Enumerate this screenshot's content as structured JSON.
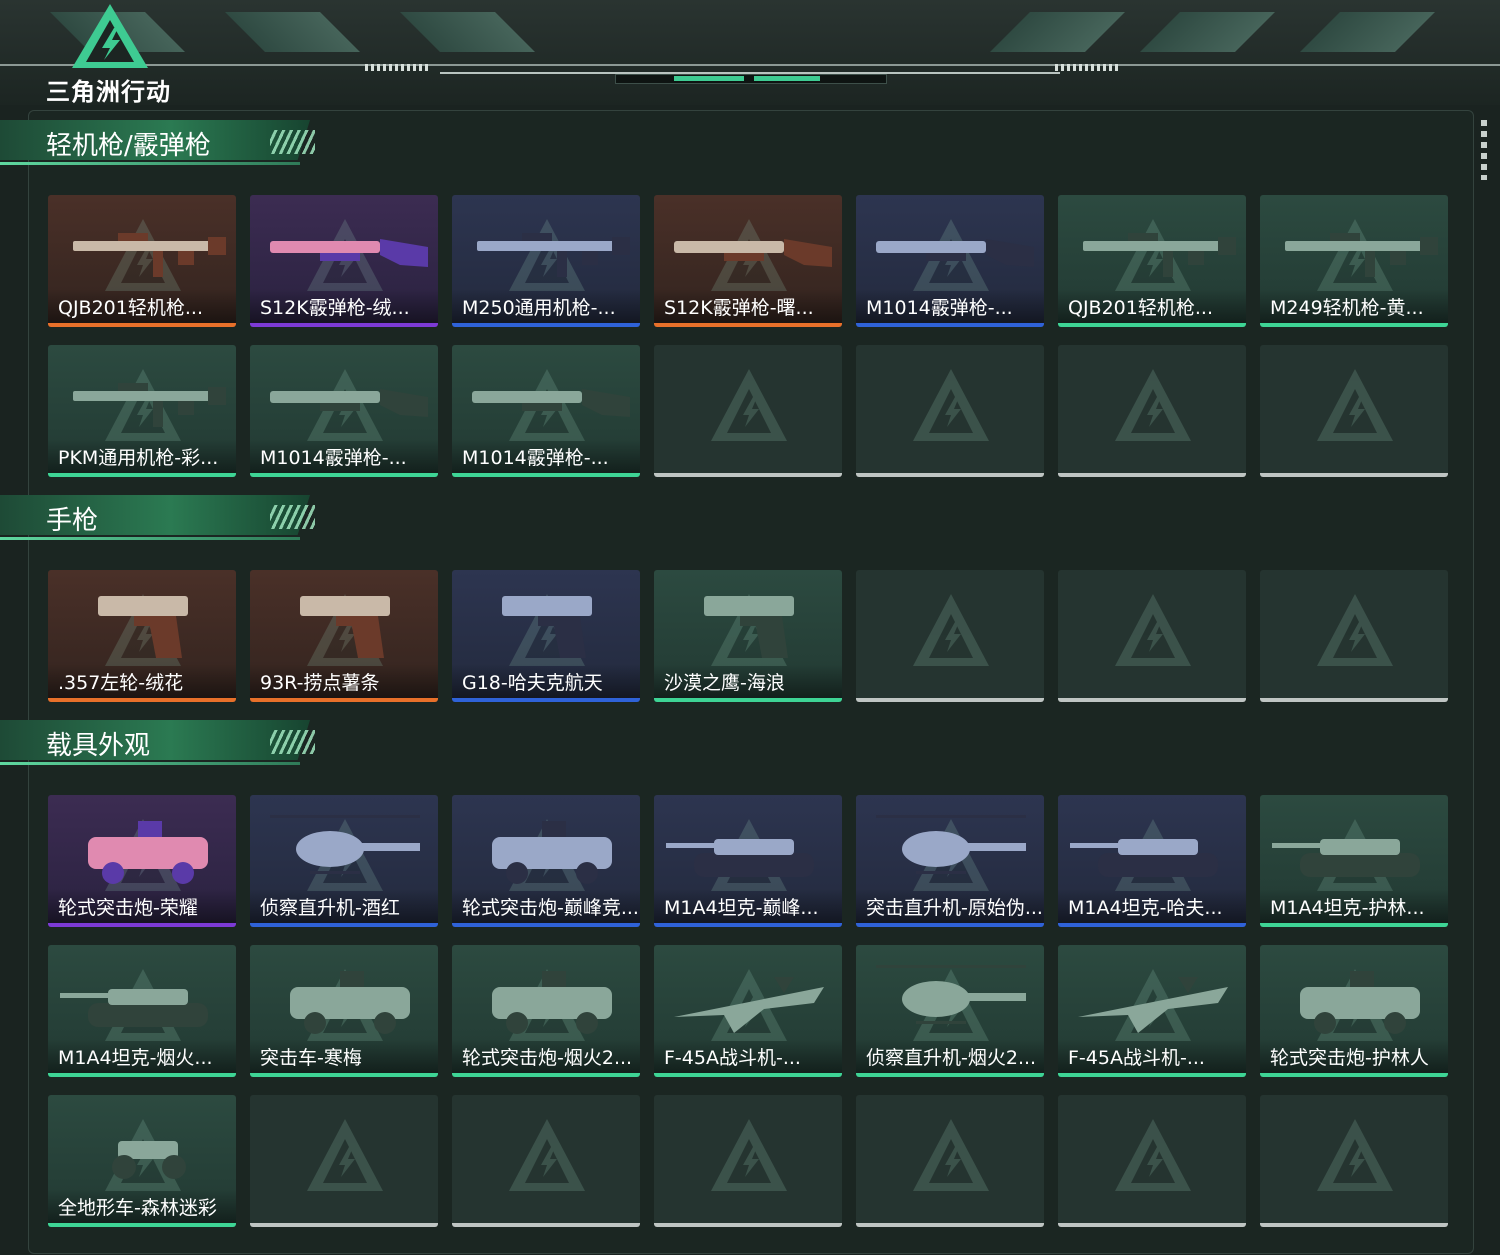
{
  "header": {
    "logo_text": "三角洲行动",
    "colors": {
      "accent": "#3ecb92",
      "panel": "#1b2622"
    }
  },
  "sections": [
    {
      "title": "轻机枪/霰弹枪",
      "items": [
        {
          "label": "QJB201轻机枪...",
          "rarity": "orange",
          "icon": "rifle-icon"
        },
        {
          "label": "S12K霰弹枪-绒...",
          "rarity": "purple",
          "icon": "shotgun-icon"
        },
        {
          "label": "M250通用机枪-...",
          "rarity": "blue",
          "icon": "rifle-icon"
        },
        {
          "label": "S12K霰弹枪-曙...",
          "rarity": "orange",
          "icon": "shotgun-icon"
        },
        {
          "label": "M1014霰弹枪-...",
          "rarity": "blue",
          "icon": "shotgun-icon"
        },
        {
          "label": "QJB201轻机枪...",
          "rarity": "green",
          "icon": "rifle-icon"
        },
        {
          "label": "M249轻机枪-黄...",
          "rarity": "green",
          "icon": "rifle-icon"
        },
        {
          "label": "PKM通用机枪-彩...",
          "rarity": "green",
          "icon": "rifle-icon"
        },
        {
          "label": "M1014霰弹枪-...",
          "rarity": "green",
          "icon": "shotgun-icon"
        },
        {
          "label": "M1014霰弹枪-...",
          "rarity": "green",
          "icon": "shotgun-icon"
        },
        null,
        null,
        null,
        null
      ]
    },
    {
      "title": "手枪",
      "items": [
        {
          "label": ".357左轮-绒花",
          "rarity": "orange",
          "icon": "pistol-icon"
        },
        {
          "label": "93R-捞点薯条",
          "rarity": "orange",
          "icon": "pistol-icon"
        },
        {
          "label": "G18-哈夫克航天",
          "rarity": "blue",
          "icon": "pistol-icon"
        },
        {
          "label": "沙漠之鹰-海浪",
          "rarity": "green",
          "icon": "pistol-icon"
        },
        null,
        null,
        null
      ]
    },
    {
      "title": "载具外观",
      "items": [
        {
          "label": "轮式突击炮-荣耀",
          "rarity": "purple",
          "icon": "armored-car-icon"
        },
        {
          "label": "侦察直升机-酒红",
          "rarity": "blue",
          "icon": "helicopter-icon"
        },
        {
          "label": "轮式突击炮-巅峰竞...",
          "rarity": "blue",
          "icon": "armored-car-icon"
        },
        {
          "label": "M1A4坦克-巅峰...",
          "rarity": "blue",
          "icon": "tank-icon"
        },
        {
          "label": "突击直升机-原始伪...",
          "rarity": "blue",
          "icon": "helicopter-icon"
        },
        {
          "label": "M1A4坦克-哈夫...",
          "rarity": "blue",
          "icon": "tank-icon"
        },
        {
          "label": "M1A4坦克-护林...",
          "rarity": "green",
          "icon": "tank-icon"
        },
        {
          "label": "M1A4坦克-烟火...",
          "rarity": "green",
          "icon": "tank-icon"
        },
        {
          "label": "突击车-寒梅",
          "rarity": "green",
          "icon": "armored-car-icon"
        },
        {
          "label": "轮式突击炮-烟火2...",
          "rarity": "green",
          "icon": "armored-car-icon"
        },
        {
          "label": "F-45A战斗机-...",
          "rarity": "green",
          "icon": "jet-icon"
        },
        {
          "label": "侦察直升机-烟火2...",
          "rarity": "green",
          "icon": "helicopter-icon"
        },
        {
          "label": "F-45A战斗机-...",
          "rarity": "green",
          "icon": "jet-icon"
        },
        {
          "label": "轮式突击炮-护林人",
          "rarity": "green",
          "icon": "armored-car-icon"
        },
        {
          "label": "全地形车-森林迷彩",
          "rarity": "green",
          "icon": "atv-icon"
        },
        null,
        null,
        null,
        null,
        null,
        null
      ]
    }
  ]
}
